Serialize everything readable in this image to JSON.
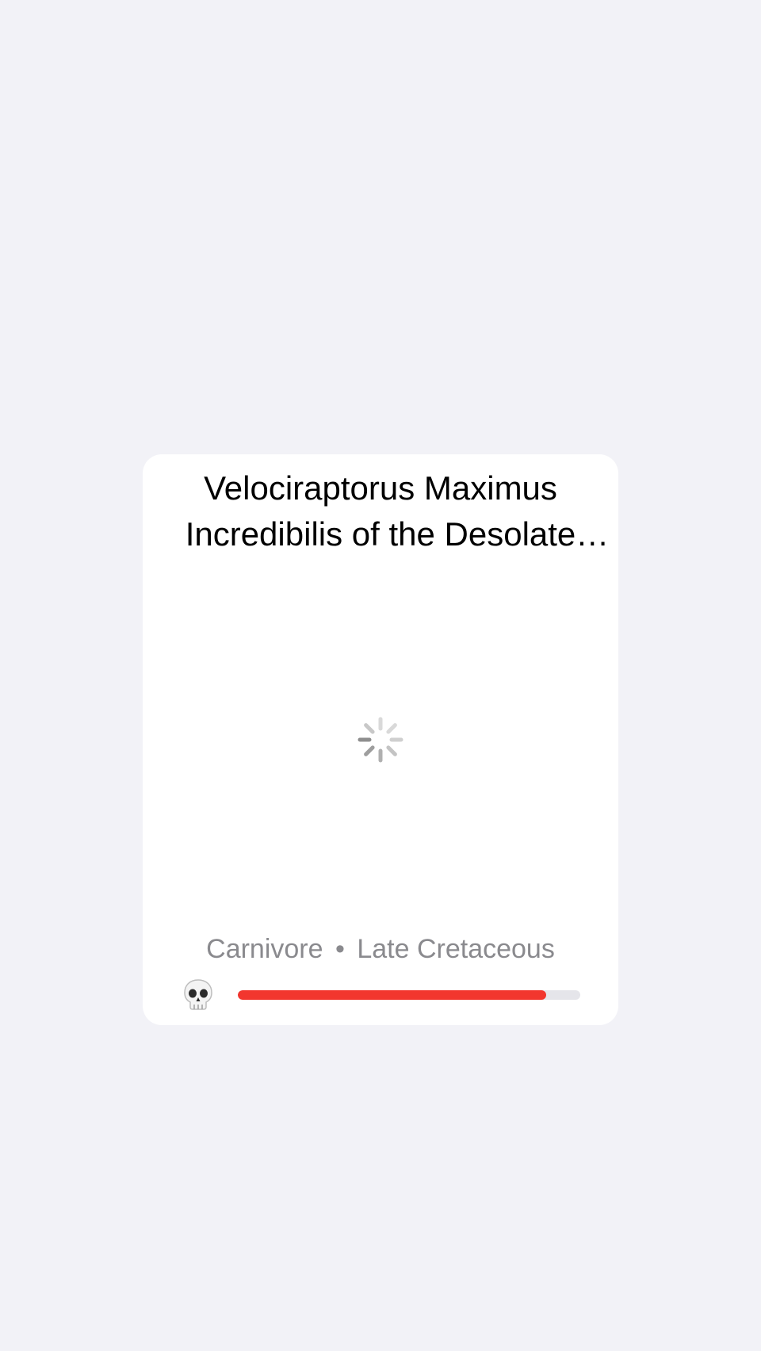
{
  "card": {
    "title": "Velociraptorus Maximus Incredibilis of the Desolate Eastern Wastelands",
    "diet": "Carnivore",
    "separator": "•",
    "period": "Late Cretaceous",
    "loading_icon": "activity-spinner-icon",
    "status_icon": "skull-icon",
    "health": {
      "fraction": 0.9,
      "fill_color": "#f2362e",
      "track_color": "#e5e5ea"
    }
  }
}
